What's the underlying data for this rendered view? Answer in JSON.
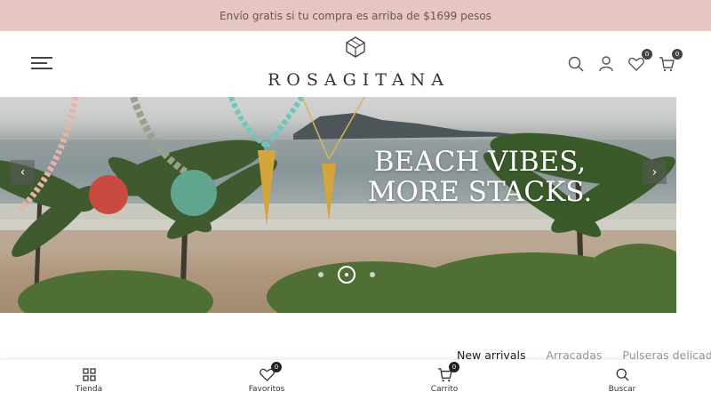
{
  "promo": {
    "text": "Envío gratis si tu compra es arriba de $1699 pesos"
  },
  "header": {
    "logo_text": "ROSAGITANA",
    "icons": {
      "menu": "hamburger-icon",
      "search": "search-icon",
      "account": "user-icon",
      "wishlist": "heart-icon",
      "cart": "bag-icon"
    },
    "wishlist_count": "0",
    "cart_count": "0"
  },
  "hero": {
    "headline_line1": "BEACH VIBES,",
    "headline_line2": "MORE STACKS.",
    "prev_glyph": "‹",
    "next_glyph": "›",
    "slides": 3,
    "active_slide": 2
  },
  "tabs": [
    {
      "label": "New arrivals",
      "active": true
    },
    {
      "label": "Arracadas",
      "active": false
    },
    {
      "label": "Pulseras delicadas",
      "active": false
    }
  ],
  "bottom_nav": [
    {
      "label": "Tienda",
      "icon": "grid-icon"
    },
    {
      "label": "Favoritos",
      "icon": "heart-icon",
      "badge": "0"
    },
    {
      "label": "Carrito",
      "icon": "bag-icon",
      "badge": "0"
    },
    {
      "label": "Buscar",
      "icon": "search-icon"
    }
  ],
  "colors": {
    "promo_bg": "#e6c6c3",
    "promo_text": "#6b5653",
    "badge_bg": "#444444"
  }
}
